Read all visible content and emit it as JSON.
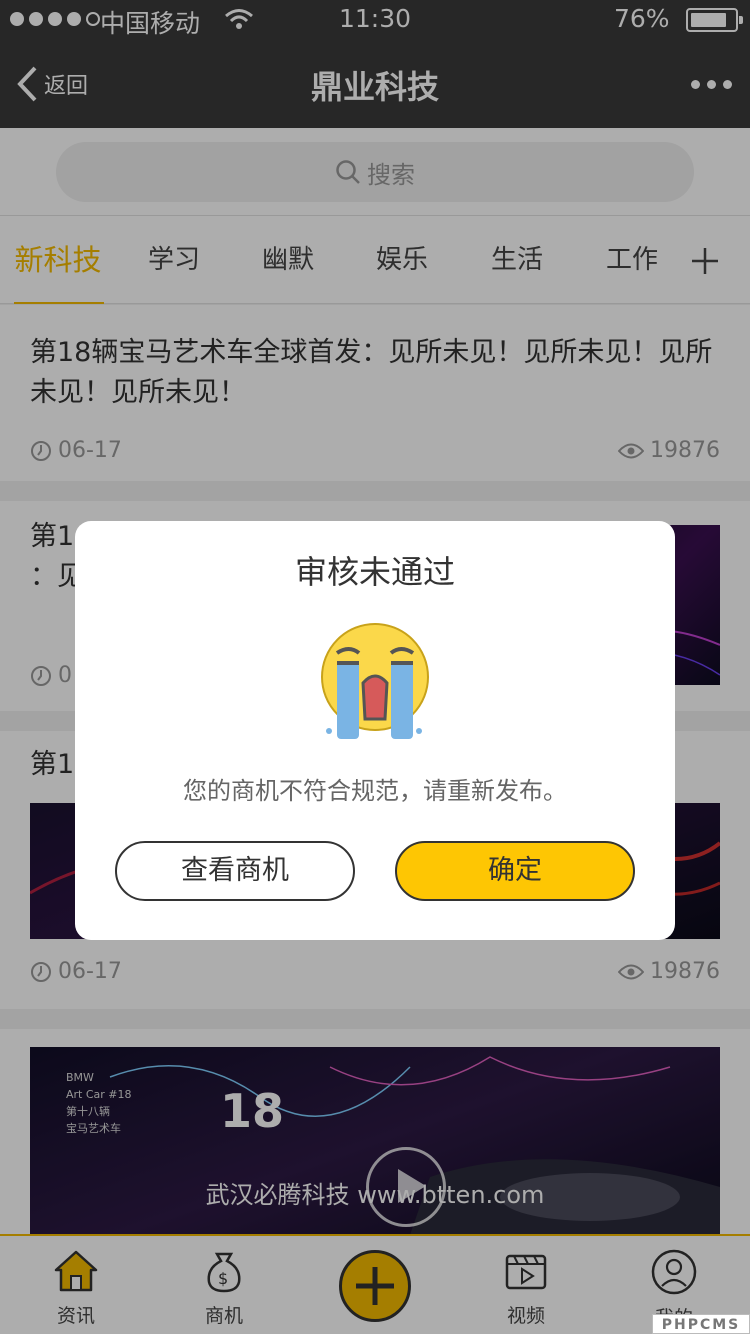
{
  "status_bar": {
    "carrier": "中国移动",
    "time": "11:30",
    "battery": "76%"
  },
  "nav": {
    "back": "返回",
    "title": "鼎业科技"
  },
  "search": {
    "placeholder": "搜索"
  },
  "tabs": [
    {
      "label": "新科技",
      "active": true
    },
    {
      "label": "学习"
    },
    {
      "label": "幽默"
    },
    {
      "label": "娱乐"
    },
    {
      "label": "生活"
    },
    {
      "label": "工作"
    }
  ],
  "feed": [
    {
      "title": "第18辆宝马艺术车全球首发：见所未见！见所未见！见所未见！见所未见！",
      "date": "06-17",
      "views": "19876"
    },
    {
      "title_visible": "第1",
      "title_line2": "：见",
      "date": "0"
    },
    {
      "title_visible": "第1",
      "date": "06-17",
      "views": "19876"
    },
    {
      "video_caption": "武汉必腾科技 www.btten.com",
      "image_text": [
        "BMW",
        "Art Car #18",
        "第十八辆",
        "宝马艺术车"
      ]
    }
  ],
  "dialog": {
    "title": "审核未通过",
    "message": "您的商机不符合规范，请重新发布。",
    "secondary_button": "查看商机",
    "primary_button": "确定"
  },
  "tabbar": [
    {
      "label": "资讯",
      "icon": "home-icon"
    },
    {
      "label": "商机",
      "icon": "money-bag-icon"
    },
    {
      "label": "",
      "icon": "plus-icon"
    },
    {
      "label": "视频",
      "icon": "video-icon"
    },
    {
      "label": "我的",
      "icon": "profile-icon"
    }
  ],
  "footer_badge": "PHPCMS",
  "colors": {
    "accent": "#f3ba00",
    "header": "#3a3a3a",
    "confirm_button": "#fec603"
  }
}
